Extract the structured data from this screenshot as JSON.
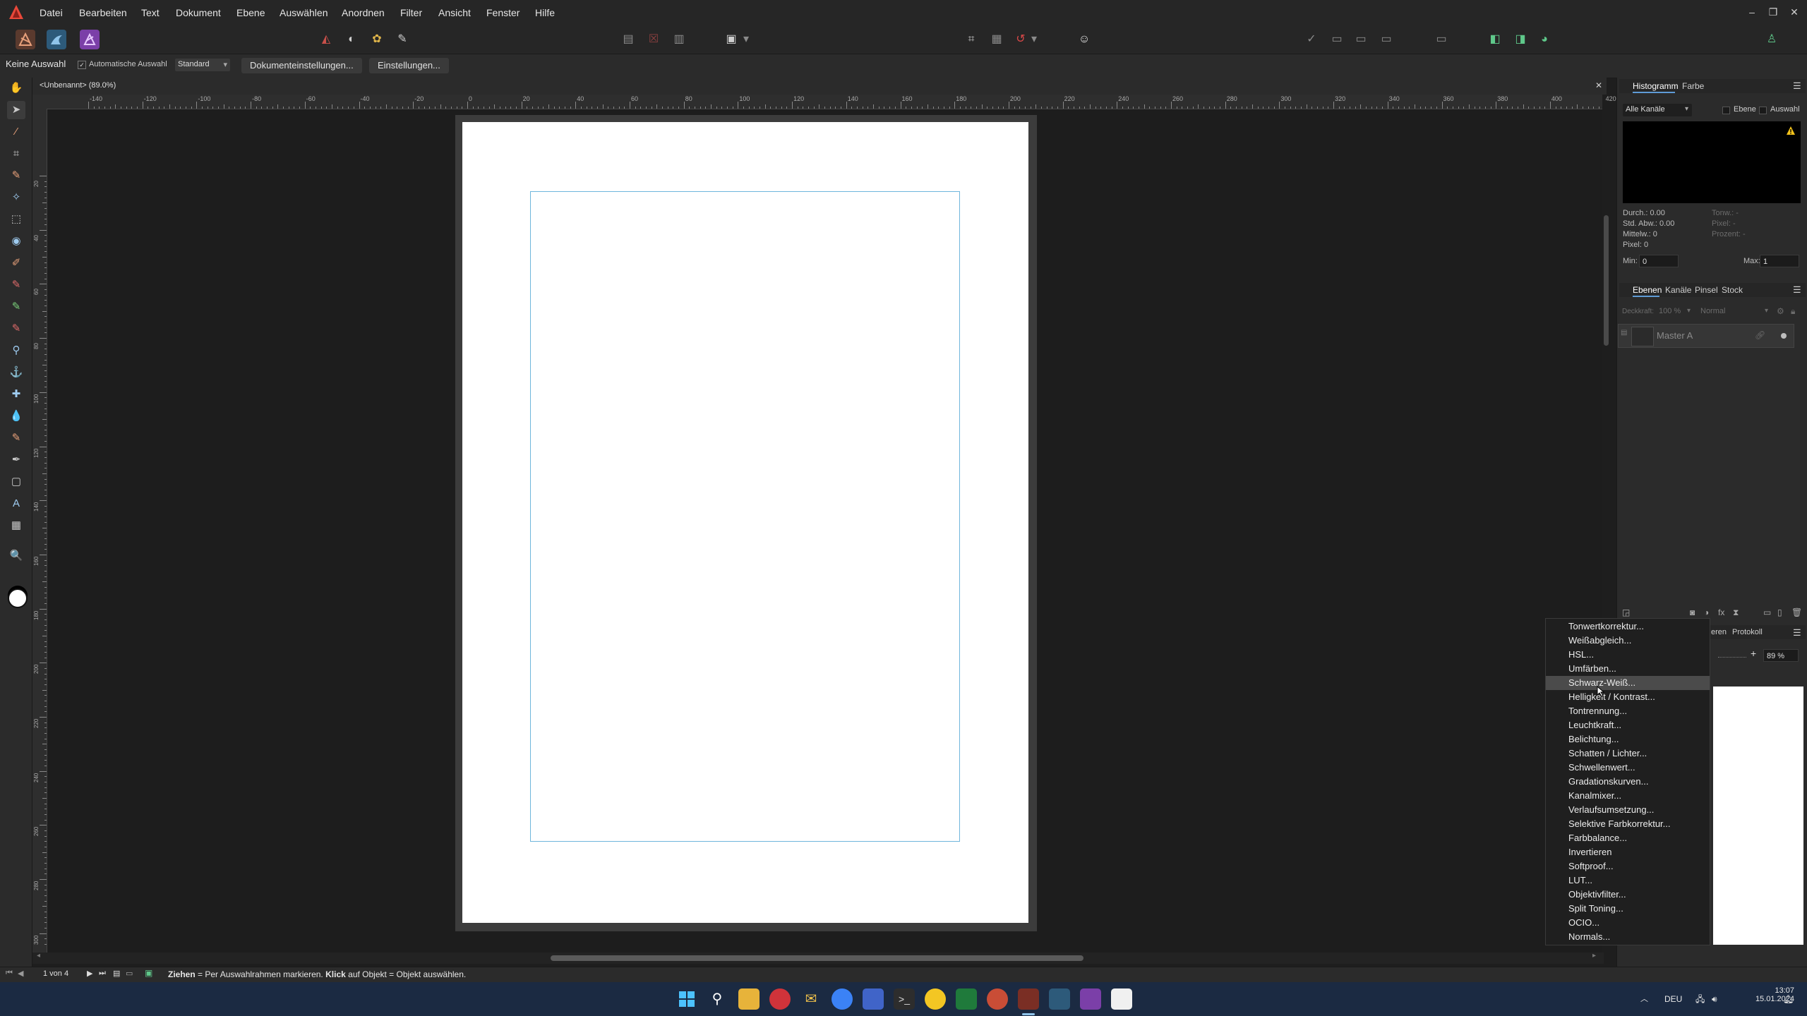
{
  "app": {
    "name": "Affinity Photo",
    "menu": [
      "Datei",
      "Bearbeiten",
      "Text",
      "Dokument",
      "Ebene",
      "Auswählen",
      "Anordnen",
      "Filter",
      "Ansicht",
      "Fenster",
      "Hilfe"
    ],
    "accent": "#e8483a"
  },
  "context_bar": {
    "selection_label": "Keine Auswahl",
    "auto_select_label": "Automatische Auswahl",
    "auto_select_checked": true,
    "mode_value": "Standard",
    "doc_settings_button": "Dokumenteinstellungen...",
    "settings_button": "Einstellungen..."
  },
  "document": {
    "tab_title": "<Unbenannt> (89.0%)",
    "ruler_h_labels": [
      "-140",
      "-120",
      "-100",
      "-80",
      "-60",
      "-40",
      "-20",
      "0",
      "20",
      "40",
      "60",
      "80",
      "100",
      "120",
      "140",
      "160",
      "180",
      "200",
      "220",
      "240",
      "260",
      "280",
      "300",
      "320",
      "340",
      "360",
      "380",
      "400",
      "420"
    ],
    "ruler_v_labels": [
      "20",
      "40",
      "60",
      "80",
      "100",
      "120",
      "140",
      "160",
      "180",
      "200",
      "220",
      "240",
      "260",
      "280",
      "300"
    ],
    "ruler_unit": "mm"
  },
  "status": {
    "page_indicator": "1 von 4",
    "hint_bold_1": "Ziehen",
    "hint_text_1": "= Per Auswahlrahmen markieren.",
    "hint_bold_2": "Klick",
    "hint_text_2": "auf Objekt = Objekt auswählen."
  },
  "histogram_panel": {
    "tabs": [
      "Histogramm",
      "Farbe"
    ],
    "channel_select": "Alle Kanäle",
    "layer_checkbox": "Ebene",
    "selection_checkbox": "Auswahl",
    "stats_left": [
      "Durch.: 0.00",
      "Std. Abw.: 0.00",
      "Mittelw.: 0",
      "Pixel: 0"
    ],
    "stats_right": [
      "Tonw.: -",
      "Pixel: -",
      "Prozent: -"
    ],
    "min_label": "Min:",
    "min_value": "0",
    "max_label": "Max:",
    "max_value": "1"
  },
  "layers_panel": {
    "tabs": [
      "Ebenen",
      "Kanäle",
      "Pinsel",
      "Stock"
    ],
    "opacity_label": "Deckkraft:",
    "opacity_value": "100 %",
    "blend_mode": "Normal",
    "layer_name": "Master A"
  },
  "navigator_panel": {
    "tab_partial": "eren",
    "tab_history": "Protokoll",
    "zoom_value": "89 %"
  },
  "adjustment_menu": {
    "items": [
      "Tonwertkorrektur...",
      "Weißabgleich...",
      "HSL...",
      "Umfärben...",
      "Schwarz-Weiß...",
      "Helligkeit / Kontrast...",
      "Tontrennung...",
      "Leuchtkraft...",
      "Belichtung...",
      "Schatten / Lichter...",
      "Schwellenwert...",
      "Gradationskurven...",
      "Kanalmixer...",
      "Verlaufsumsetzung...",
      "Selektive Farbkorrektur...",
      "Farbbalance...",
      "Invertieren",
      "Softproof...",
      "LUT...",
      "Objektivfilter...",
      "Split Toning...",
      "OCIO...",
      "Normals..."
    ],
    "highlighted_index": 4
  },
  "taskbar": {
    "language": "DEU",
    "time": "13:07",
    "date": "15.01.2024"
  }
}
